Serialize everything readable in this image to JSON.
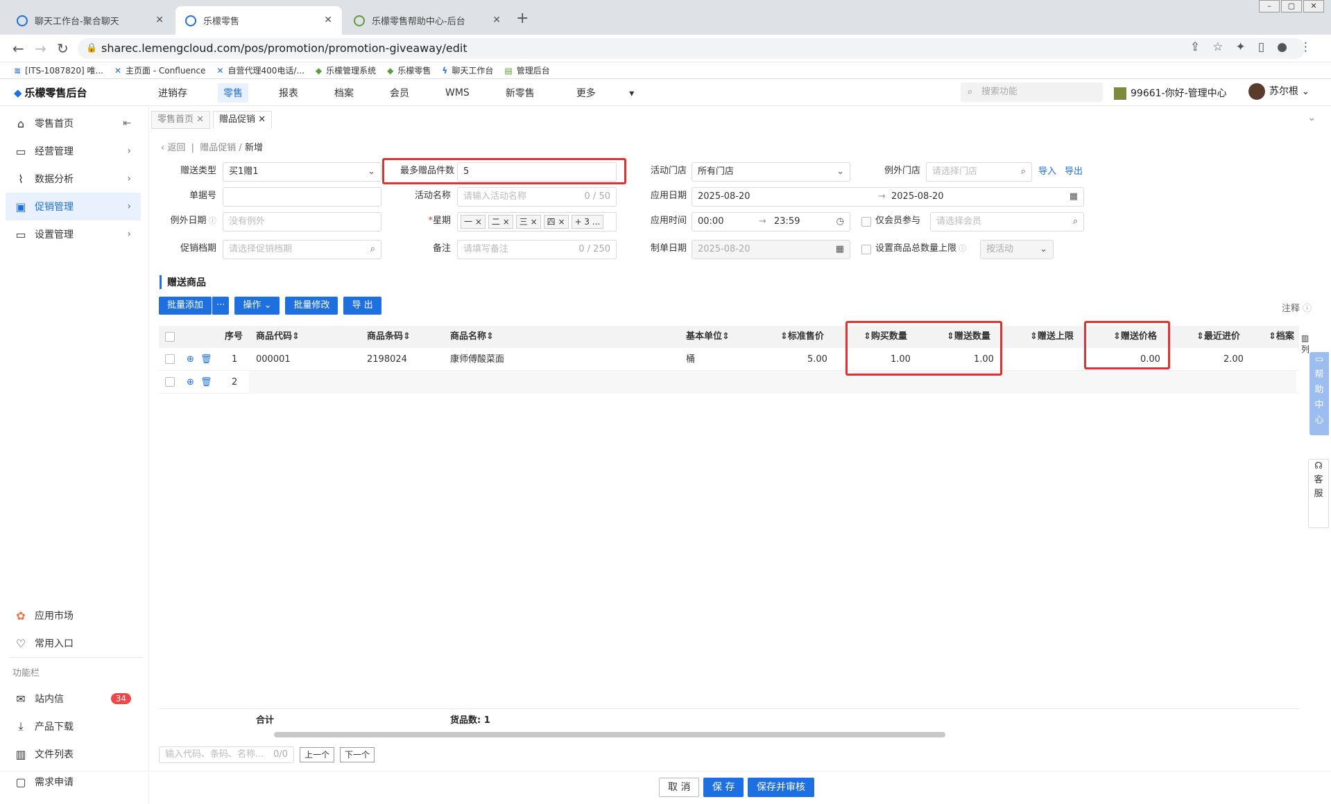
{
  "browser": {
    "tabs": [
      {
        "label": "聊天工作台-聚合聊天",
        "active": false
      },
      {
        "label": "乐檬零售",
        "active": true
      },
      {
        "label": "乐檬零售帮助中心-后台",
        "active": false
      }
    ],
    "url": "sharec.lemengcloud.com/pos/promotion/promotion-giveaway/edit",
    "bookmarks": [
      "[ITS-1087820] 唯...",
      "主页面 - Confluence",
      "自营代理400电话/...",
      "乐檬管理系统",
      "乐檬零售",
      "聊天工作台",
      "管理后台"
    ]
  },
  "header": {
    "brand": "乐檬零售后台",
    "nav": [
      "进销存",
      "零售",
      "报表",
      "档案",
      "会员",
      "WMS",
      "新零售",
      "更多"
    ],
    "active_nav": "零售",
    "search_placeholder": "搜索功能",
    "store": "99661-你好-管理中心",
    "user": "苏尔根"
  },
  "sidebar": {
    "items": [
      {
        "label": "零售首页",
        "icon": "home-icon"
      },
      {
        "label": "经营管理",
        "icon": "monitor-icon"
      },
      {
        "label": "数据分析",
        "icon": "chart-icon"
      },
      {
        "label": "促销管理",
        "icon": "promotion-icon"
      },
      {
        "label": "设置管理",
        "icon": "folder-icon"
      }
    ],
    "bottom": {
      "app_market": "应用市场",
      "favorites": "常用入口",
      "section": "功能栏",
      "messages": "站内信",
      "messages_count": "34",
      "download": "产品下载",
      "files": "文件列表",
      "requests": "需求申请"
    }
  },
  "pagetabs": [
    "零售首页",
    "赠品促销"
  ],
  "breadcrumb": {
    "back": "返回",
    "parent": "赠品促销",
    "current": "新增"
  },
  "form": {
    "gift_type_label": "赠送类型",
    "gift_type_value": "买1赠1",
    "max_gift_label": "最多赠品件数",
    "max_gift_value": "5",
    "store_label": "活动门店",
    "store_value": "所有门店",
    "except_store_label": "例外门店",
    "except_store_placeholder": "请选择门店",
    "import": "导入",
    "export": "导出",
    "doc_no_label": "单据号",
    "activity_name_label": "活动名称",
    "activity_name_placeholder": "请输入活动名称",
    "activity_name_count": "0 / 50",
    "apply_date_label": "应用日期",
    "date_start": "2025-08-20",
    "date_end": "2025-08-20",
    "except_date_label": "例外日期",
    "except_date_placeholder": "没有例外",
    "week_label": "星期",
    "week_tags": [
      "一",
      "二",
      "三",
      "四",
      "+ 3 ..."
    ],
    "apply_time_label": "应用时间",
    "time_start": "00:00",
    "time_end": "23:59",
    "member_only": "仅会员参与",
    "member_placeholder": "请选择会员",
    "period_label": "促销档期",
    "period_placeholder": "请选择促销档期",
    "remark_label": "备注",
    "remark_placeholder": "请填写备注",
    "remark_count": "0 / 250",
    "create_date_label": "制单日期",
    "create_date": "2025-08-20",
    "limit_label": "设置商品总数量上限",
    "limit_mode": "按活动"
  },
  "section_title": "赠送商品",
  "toolbar": {
    "batch_add": "批量添加",
    "more": "···",
    "operation": "操作",
    "batch_edit": "批量修改",
    "export": "导 出",
    "notes": "注释"
  },
  "table": {
    "headers": [
      "序号",
      "商品代码",
      "商品条码",
      "商品名称",
      "基本单位",
      "标准售价",
      "购买数量",
      "赠送数量",
      "赠送上限",
      "赠送价格",
      "最近进价",
      "档案"
    ],
    "rows": [
      {
        "no": "1",
        "code": "000001",
        "barcode": "2198024",
        "name": "康师傅酸菜面",
        "unit": "桶",
        "price": "5.00",
        "buy_qty": "1.00",
        "gift_qty": "1.00",
        "gift_limit": "",
        "gift_price": "0.00",
        "last_cost": "2.00"
      },
      {
        "no": "2",
        "code": "",
        "barcode": "",
        "name": "",
        "unit": "",
        "price": "",
        "buy_qty": "",
        "gift_qty": "",
        "gift_limit": "",
        "gift_price": "",
        "last_cost": ""
      }
    ],
    "summary_label": "合计",
    "summary_count": "货品数: 1",
    "col_setting": "列"
  },
  "pager": {
    "placeholder": "输入代码、条码、名称...",
    "count": "0/0",
    "prev": "上一个",
    "next": "下一个"
  },
  "footer": {
    "cancel": "取 消",
    "save": "保 存",
    "save_audit": "保存并审核"
  },
  "side_widgets": {
    "help": "帮助中心",
    "service": "客服"
  }
}
